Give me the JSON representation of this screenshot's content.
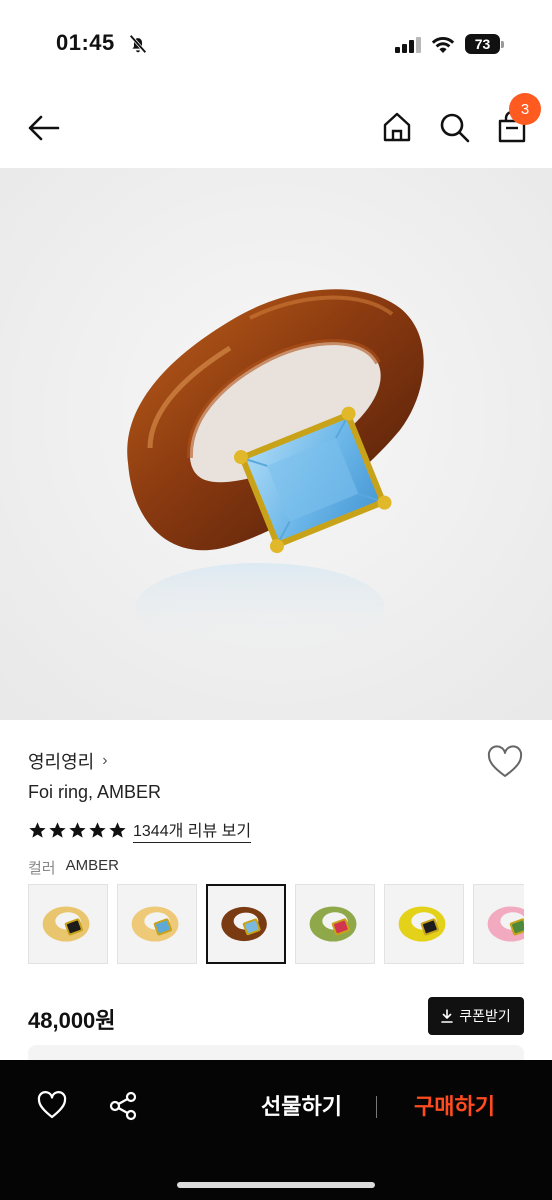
{
  "status_bar": {
    "time": "01:45",
    "battery": "73"
  },
  "header": {
    "cart_count": "3"
  },
  "product": {
    "brand": "영리영리",
    "brand_chevron": "›",
    "name": "Foi ring, AMBER",
    "rating": 5,
    "review_link": "1344개 리뷰 보기",
    "color_label": "컬러",
    "color_value": "AMBER",
    "price": "48,000원",
    "coupon_label": "쿠폰받기"
  },
  "swatches": [
    {
      "band": "#e9c66e",
      "stone": "#1b1b1b",
      "selected": false
    },
    {
      "band": "#edc978",
      "stone": "#5fa9d8",
      "selected": false
    },
    {
      "band": "#7a3a12",
      "stone": "#7ab8e0",
      "selected": true
    },
    {
      "band": "#8ea84a",
      "stone": "#d1354f",
      "selected": false
    },
    {
      "band": "#e4d21a",
      "stone": "#1d1d1d",
      "selected": false
    },
    {
      "band": "#f2aac0",
      "stone": "#4f8a3a",
      "selected": false
    }
  ],
  "bottom_bar": {
    "gift_label": "선물하기",
    "buy_label": "구매하기"
  },
  "colors": {
    "accent": "#ff4b1f",
    "badge": "#ff5a1f",
    "bottom_bar": "#050505"
  },
  "icons": [
    "bell-off-icon",
    "signal-icon",
    "wifi-icon",
    "battery-icon",
    "back-arrow-icon",
    "home-icon",
    "search-icon",
    "cart-icon",
    "heart-icon",
    "star-icon",
    "download-icon",
    "share-icon"
  ]
}
